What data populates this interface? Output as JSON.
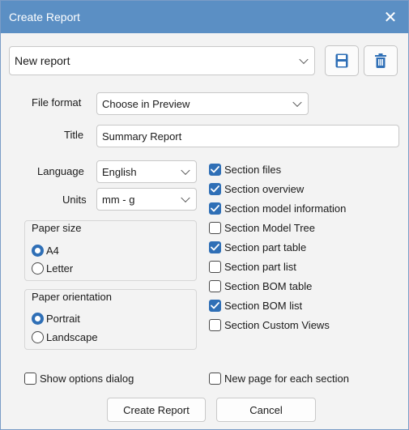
{
  "window": {
    "title": "Create Report",
    "close_symbol": "✕"
  },
  "report_select": {
    "value": "New report"
  },
  "file_format": {
    "label": "File format",
    "value": "Choose in Preview"
  },
  "title_field": {
    "label": "Title",
    "value": "Summary Report"
  },
  "language": {
    "label": "Language",
    "value": "English"
  },
  "units": {
    "label": "Units",
    "value": "mm - g"
  },
  "paper_size": {
    "title": "Paper size",
    "options": [
      {
        "label": "A4",
        "selected": true
      },
      {
        "label": "Letter",
        "selected": false
      }
    ]
  },
  "paper_orientation": {
    "title": "Paper orientation",
    "options": [
      {
        "label": "Portrait",
        "selected": true
      },
      {
        "label": "Landscape",
        "selected": false
      }
    ]
  },
  "sections": [
    {
      "label": "Section files",
      "checked": true
    },
    {
      "label": "Section overview",
      "checked": true
    },
    {
      "label": "Section model information",
      "checked": true
    },
    {
      "label": "Section Model Tree",
      "checked": false
    },
    {
      "label": "Section part table",
      "checked": true
    },
    {
      "label": "Section part list",
      "checked": false
    },
    {
      "label": "Section BOM table",
      "checked": false
    },
    {
      "label": "Section BOM list",
      "checked": true
    },
    {
      "label": "Section Custom Views",
      "checked": false
    }
  ],
  "show_options_dialog": {
    "label": "Show options dialog",
    "checked": false
  },
  "new_page_each_section": {
    "label": "New page for each section",
    "checked": false
  },
  "buttons": {
    "create": "Create Report",
    "cancel": "Cancel"
  },
  "icons": {
    "save": "save-icon",
    "delete": "trash-icon",
    "checkmark": "checkmark-icon"
  },
  "colors": {
    "titlebar": "#5b8fc4",
    "accent": "#2f6fb6"
  }
}
